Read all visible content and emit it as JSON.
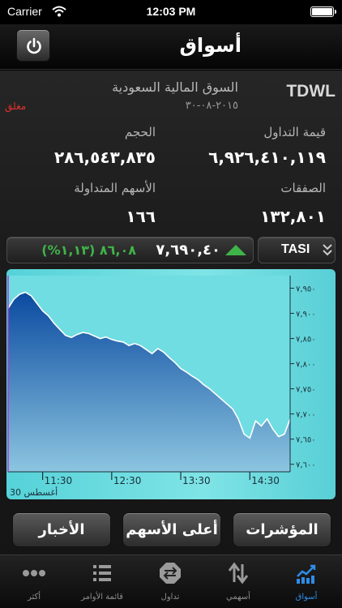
{
  "status_bar": {
    "carrier": "Carrier",
    "time": "12:03 PM",
    "battery_level": 1.0
  },
  "nav": {
    "title": "أسواق"
  },
  "market": {
    "code": "TDWL",
    "name": "السوق المالية السعودية",
    "date": "٢٠١٥-٠٨-٣٠",
    "status": "مغلق",
    "turnover_label": "قيمة التداول",
    "turnover_value": "٦,٩٢٦,٤١٠,١١٩",
    "volume_label": "الحجم",
    "volume_value": "٢٨٦,٥٤٣,٨٣٥",
    "trades_label": "الصفقات",
    "trades_value": "١٣٢,٨٠١",
    "traded_shares_label": "الأسهم المتداولة",
    "traded_shares_value": "١٦٦"
  },
  "index": {
    "name": "TASI",
    "value": "٧,٦٩٠,٤٠",
    "change": "٨٦,٠٨ (١,١٣%)",
    "direction": "up",
    "up_color": "#3fb548"
  },
  "chart_data": {
    "type": "area",
    "x": [
      "11:00",
      "11:05",
      "11:10",
      "11:15",
      "11:20",
      "11:25",
      "11:30",
      "11:35",
      "11:40",
      "11:45",
      "11:50",
      "11:55",
      "12:00",
      "12:05",
      "12:10",
      "12:15",
      "12:20",
      "12:25",
      "12:30",
      "12:35",
      "12:40",
      "12:45",
      "12:50",
      "12:55",
      "13:00",
      "13:05",
      "13:10",
      "13:15",
      "13:20",
      "13:25",
      "13:30",
      "13:35",
      "13:40",
      "13:45",
      "13:50",
      "13:55",
      "14:00",
      "14:05",
      "14:10",
      "14:15",
      "14:20",
      "14:25",
      "14:30",
      "14:35",
      "14:40",
      "14:45",
      "14:50",
      "14:55",
      "15:00",
      "15:05"
    ],
    "y": [
      7910,
      7928,
      7938,
      7942,
      7935,
      7920,
      7905,
      7895,
      7880,
      7868,
      7856,
      7852,
      7858,
      7862,
      7860,
      7855,
      7850,
      7853,
      7848,
      7845,
      7843,
      7836,
      7840,
      7836,
      7828,
      7820,
      7830,
      7823,
      7812,
      7802,
      7790,
      7783,
      7775,
      7768,
      7758,
      7750,
      7740,
      7730,
      7720,
      7710,
      7690,
      7660,
      7652,
      7686,
      7676,
      7690,
      7670,
      7655,
      7660,
      7690
    ],
    "x_ticks": [
      "11:30",
      "12:30",
      "13:30",
      "14:30"
    ],
    "y_ticks": [
      "٧,٩٥٠",
      "٧,٩٠٠",
      "٧,٨٥٠",
      "٧,٨٠٠",
      "٧,٧٥٠",
      "٧,٧٠٠",
      "٧,٦٥٠",
      "٧,٦٠٠"
    ],
    "y_tick_values": [
      7950,
      7900,
      7850,
      7800,
      7750,
      7700,
      7650,
      7600
    ],
    "ylim": [
      7585,
      7975
    ],
    "date_label": "30 أغسطس",
    "fill_top_color": "#0a4aa0",
    "fill_bottom_color": "#8cc5e0",
    "background_color": "#6fdde2"
  },
  "actions": {
    "indices": "المؤشرات",
    "top_stocks": "أعلى الأسهم",
    "news": "الأخبار"
  },
  "tabs": [
    {
      "label": "أسواق",
      "icon": "markets-chart-icon",
      "active": true
    },
    {
      "label": "أسهمي",
      "icon": "up-down-arrows-icon",
      "active": false
    },
    {
      "label": "تداول",
      "icon": "trade-exchange-icon",
      "active": false
    },
    {
      "label": "قائمة الأوامر",
      "icon": "list-icon",
      "active": false
    },
    {
      "label": "أكثر",
      "icon": "more-dots-icon",
      "active": false
    }
  ]
}
